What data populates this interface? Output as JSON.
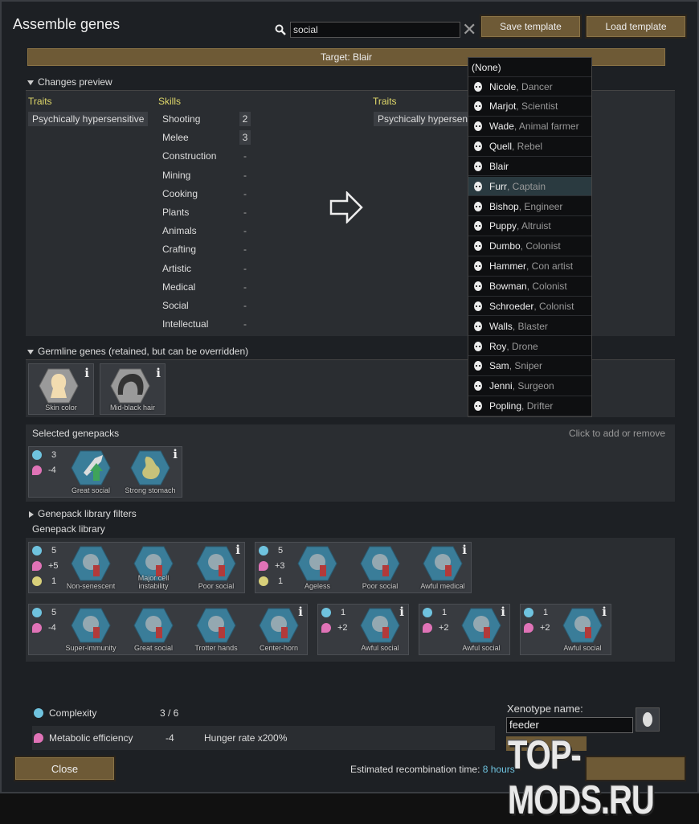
{
  "window": {
    "title": "Assemble genes",
    "save_template": "Save template",
    "load_template": "Load template",
    "search_value": "social",
    "target": "Target: Blair"
  },
  "changes_preview": {
    "label": "Changes preview",
    "traits_header": "Traits",
    "skills_header": "Skills",
    "trait_before": "Psychically hypersensitive",
    "traits_header_after": "Traits",
    "trait_after": "Psychically hypersen",
    "skills": [
      {
        "name": "Shooting",
        "value": "2"
      },
      {
        "name": "Melee",
        "value": "3"
      },
      {
        "name": "Construction",
        "value": "-"
      },
      {
        "name": "Mining",
        "value": "-"
      },
      {
        "name": "Cooking",
        "value": "-"
      },
      {
        "name": "Plants",
        "value": "-"
      },
      {
        "name": "Animals",
        "value": "-"
      },
      {
        "name": "Crafting",
        "value": "-"
      },
      {
        "name": "Artistic",
        "value": "-"
      },
      {
        "name": "Medical",
        "value": "-"
      },
      {
        "name": "Social",
        "value": "-"
      },
      {
        "name": "Intellectual",
        "value": "-"
      }
    ]
  },
  "germline": {
    "label": "Germline genes (retained, but can be overridden)",
    "genes": [
      "Skin color",
      "Mid-black hair"
    ]
  },
  "selected": {
    "label": "Selected genepacks",
    "hint": "Click to add or remove",
    "complexity": "3",
    "metabolic": "-4",
    "genes": [
      "Great social",
      "Strong stomach"
    ]
  },
  "library": {
    "filters_label": "Genepack library filters",
    "label": "Genepack library",
    "packs": [
      {
        "cx": "5",
        "met": "+5",
        "arc": "1",
        "genes": [
          "Non-senescent",
          "Major cell instability",
          "Poor social"
        ]
      },
      {
        "cx": "5",
        "met": "+3",
        "arc": "1",
        "genes": [
          "Ageless",
          "Poor social",
          "Awful medical"
        ]
      },
      {
        "cx": "5",
        "met": "-4",
        "genes": [
          "Super-immunity",
          "Great social",
          "Trotter hands",
          "Center-horn"
        ]
      },
      {
        "cx": "1",
        "met": "+2",
        "genes": [
          "Awful social"
        ]
      },
      {
        "cx": "1",
        "met": "+2",
        "genes": [
          "Awful social"
        ]
      },
      {
        "cx": "1",
        "met": "+2",
        "genes": [
          "Awful social"
        ]
      }
    ]
  },
  "dropdown": {
    "none": "(None)",
    "items": [
      {
        "name": "Nicole",
        "role": ", Dancer"
      },
      {
        "name": "Marjot",
        "role": ", Scientist"
      },
      {
        "name": "Wade",
        "role": ", Animal farmer"
      },
      {
        "name": "Quell",
        "role": ", Rebel"
      },
      {
        "name": "Blair",
        "role": ""
      },
      {
        "name": "Furr",
        "role": ", Captain"
      },
      {
        "name": "Bishop",
        "role": ", Engineer"
      },
      {
        "name": "Puppy",
        "role": ", Altruist"
      },
      {
        "name": "Dumbo",
        "role": ", Colonist"
      },
      {
        "name": "Hammer",
        "role": ", Con artist"
      },
      {
        "name": "Bowman",
        "role": ", Colonist"
      },
      {
        "name": "Schroeder",
        "role": ", Colonist"
      },
      {
        "name": "Walls",
        "role": ", Blaster"
      },
      {
        "name": "Roy",
        "role": ", Drone"
      },
      {
        "name": "Sam",
        "role": ", Sniper"
      },
      {
        "name": "Jenni",
        "role": ", Surgeon"
      },
      {
        "name": "Popling",
        "role": ", Drifter"
      }
    ]
  },
  "bottom": {
    "complexity_label": "Complexity",
    "complexity_value": "3 / 6",
    "metabolic_label": "Metabolic efficiency",
    "metabolic_value": "-4",
    "hunger": "Hunger rate x200%",
    "xeno_label": "Xenotype name:",
    "xeno_value": "feeder",
    "close": "Close",
    "recomb_label": "Estimated recombination time: ",
    "recomb_value": "8 hours",
    "watermark": "TOP-MODS.RU"
  }
}
